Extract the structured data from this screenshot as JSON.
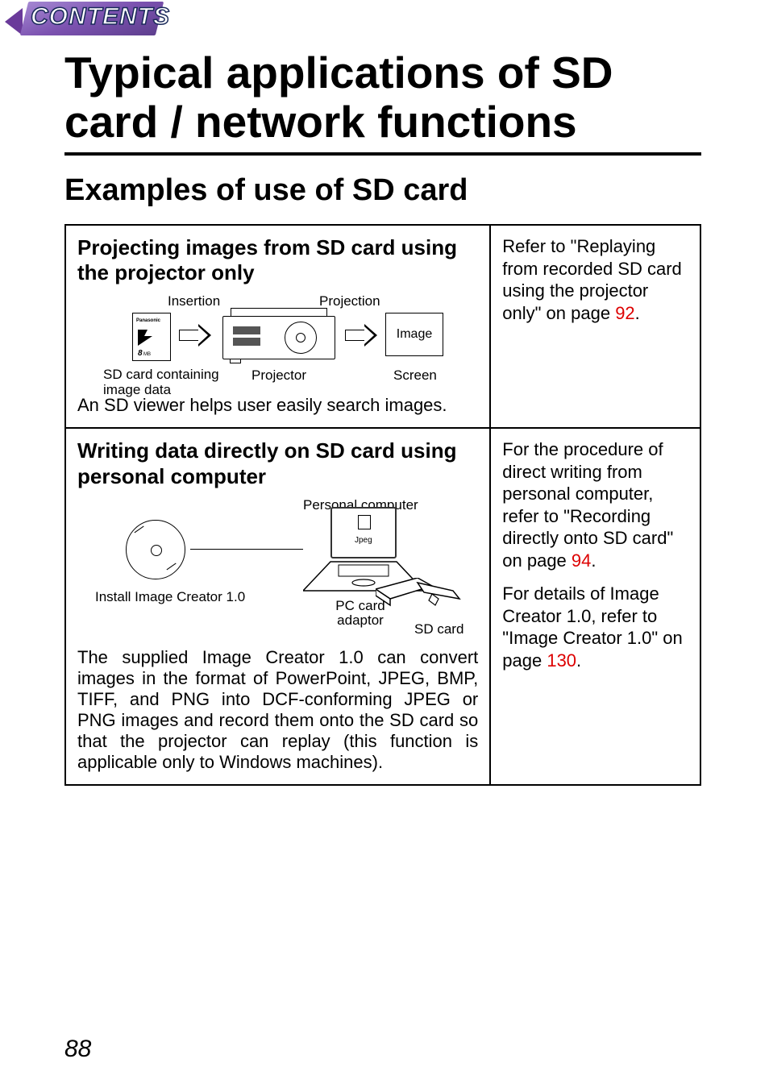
{
  "header": {
    "tab": "CONTENTS"
  },
  "title": "Typical applications of SD card / network functions",
  "subtitle": "Examples of use of SD card",
  "row1": {
    "heading": "Projecting images from SD card using the projector only",
    "labels": {
      "insertion": "Insertion",
      "projection": "Projection",
      "image": "Image",
      "sd_caption": "SD card containing image data",
      "projector": "Projector",
      "screen": "Screen"
    },
    "desc": "An SD viewer helps user easily search images.",
    "ref": {
      "text_a": "Refer to \"Replaying from recorded SD card using the projector only\" on page ",
      "page": "92",
      "tail": "."
    }
  },
  "row2": {
    "heading": "Writing data directly on SD card using personal computer",
    "labels": {
      "pc": "Personal computer",
      "install": "Install Image Creator 1.0",
      "pc_card_adaptor": "PC card adaptor",
      "sd_card": "SD card",
      "jpeg": "Jpeg"
    },
    "desc": "The supplied Image Creator 1.0 can convert images in the format of PowerPoint, JPEG, BMP, TIFF, and PNG into DCF-conforming JPEG or PNG images and record them onto the SD card so that the projector can replay (this function is applicable only to Windows machines).",
    "ref": {
      "p1a": "For the procedure of direct writing from personal computer, refer to \"Recording directly onto SD card\" on page ",
      "p1page": "94",
      "p1tail": ".",
      "p2a": "For details of Image Creator 1.0, refer to \"Image Creator 1.0\" on page ",
      "p2page": "130",
      "p2tail": "."
    }
  },
  "page_number": "88"
}
